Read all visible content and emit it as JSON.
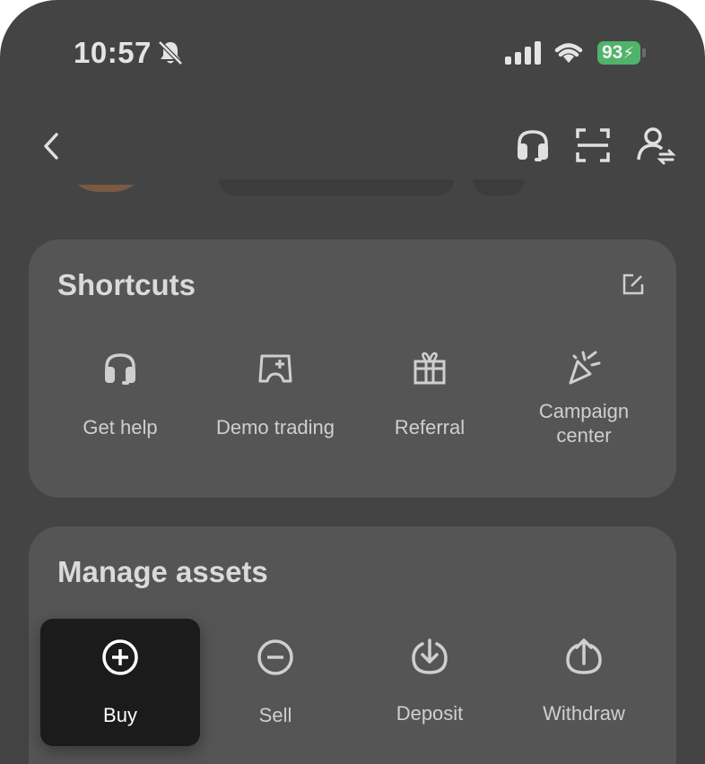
{
  "status_bar": {
    "time": "10:57",
    "battery": "93"
  },
  "shortcuts": {
    "title": "Shortcuts",
    "items": [
      {
        "label": "Get help",
        "icon": "headset-icon"
      },
      {
        "label": "Demo trading",
        "icon": "demo-trading-icon"
      },
      {
        "label": "Referral",
        "icon": "gift-icon"
      },
      {
        "label": "Campaign center",
        "icon": "party-popper-icon"
      }
    ]
  },
  "manage_assets": {
    "title": "Manage assets",
    "items": [
      {
        "label": "Buy",
        "icon": "plus-circle-icon"
      },
      {
        "label": "Sell",
        "icon": "minus-circle-icon"
      },
      {
        "label": "Deposit",
        "icon": "deposit-icon"
      },
      {
        "label": "Withdraw",
        "icon": "withdraw-icon"
      }
    ]
  }
}
